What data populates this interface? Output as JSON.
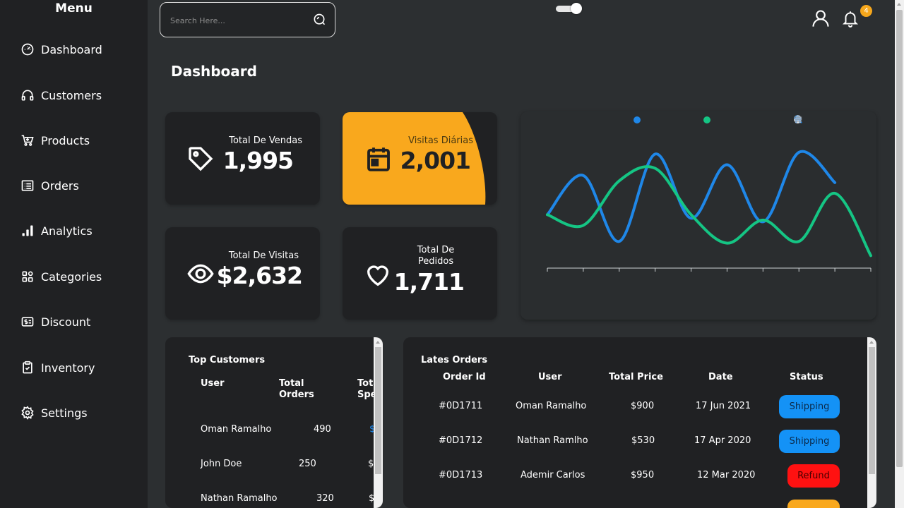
{
  "sidebar": {
    "title": "Menu",
    "items": [
      {
        "label": "Dashboard",
        "icon": "gauge-icon"
      },
      {
        "label": "Customers",
        "icon": "headphones-icon"
      },
      {
        "label": "Products",
        "icon": "cart-icon"
      },
      {
        "label": "Orders",
        "icon": "list-icon"
      },
      {
        "label": "Analytics",
        "icon": "bar-chart-icon"
      },
      {
        "label": "Categories",
        "icon": "grid-icon"
      },
      {
        "label": "Discount",
        "icon": "dollar-tag-icon"
      },
      {
        "label": "Inventory",
        "icon": "clipboard-check-icon"
      },
      {
        "label": "Settings",
        "icon": "gear-icon"
      }
    ]
  },
  "header": {
    "search_placeholder": "Search Here...",
    "notification_count": "4"
  },
  "page_title": "Dashboard",
  "stats": [
    {
      "label": "Total De Vendas",
      "value": "1,995",
      "icon": "tag-icon"
    },
    {
      "label": "Visitas Diárias",
      "value": "2,001",
      "icon": "calendar-icon"
    },
    {
      "label": "Total De Visitas",
      "value": "$2,632",
      "icon": "eye-icon"
    },
    {
      "label": "Total De Pedidos",
      "value": "1,711",
      "icon": "heart-icon"
    }
  ],
  "colors": {
    "accent": "#f9a81d",
    "series1": "#1f87e8",
    "series2": "#15c584",
    "shipping": "#1492f6",
    "refund": "#ff1111"
  },
  "chart_data": {
    "type": "line",
    "smooth": true,
    "grid": false,
    "legend": "top-center",
    "x": [
      0,
      1,
      2,
      3,
      4,
      5,
      6,
      7,
      8,
      9
    ],
    "series": [
      {
        "values": [
          300,
          520,
          150,
          640,
          280,
          580,
          260,
          650,
          480,
          null
        ]
      },
      {
        "values": [
          300,
          240,
          490,
          560,
          300,
          140,
          270,
          150,
          420,
          70
        ]
      }
    ],
    "ylim": [
      0,
      800
    ]
  },
  "top_customers": {
    "title": "Top Customers",
    "columns": [
      "User",
      "Total Orders",
      "Total Spent"
    ],
    "rows": [
      {
        "user": "Oman Ramalho",
        "orders": "490",
        "spent": "$"
      },
      {
        "user": "John Doe",
        "orders": "250",
        "spent": "$"
      },
      {
        "user": "Nathan Ramalho",
        "orders": "320",
        "spent": "$"
      }
    ]
  },
  "latest_orders": {
    "title": "Lates Orders",
    "columns": [
      "Order Id",
      "User",
      "Total Price",
      "Date",
      "Status"
    ],
    "rows": [
      {
        "id": "#0D1711",
        "user": "Oman Ramalho",
        "price": "$900",
        "date": "17 Jun 2021",
        "status": "Shipping"
      },
      {
        "id": "#0D1712",
        "user": "Nathan Ramlho",
        "price": "$530",
        "date": "17 Apr 2020",
        "status": "Shipping"
      },
      {
        "id": "#0D1713",
        "user": "Ademir Carlos",
        "price": "$950",
        "date": "12 Mar 2020",
        "status": "Refund"
      }
    ]
  }
}
